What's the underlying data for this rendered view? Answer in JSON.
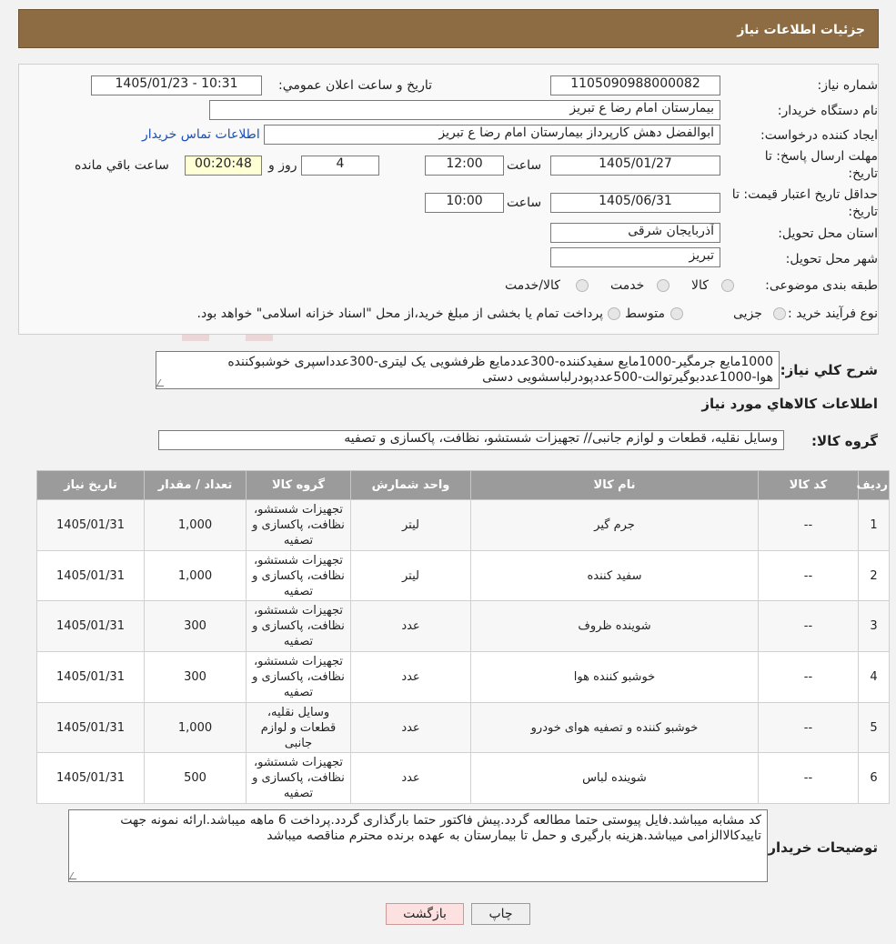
{
  "header": {
    "title": "جزئیات اطلاعات نیاز"
  },
  "form": {
    "need_number_label": "شماره نیاز:",
    "need_number": "1105090988000082",
    "announce_label": "تاریخ و ساعت اعلان عمومي:",
    "announce_value": "1405/01/23 - 10:31",
    "buyer_org_label": "نام دستگاه خريدار:",
    "buyer_org": "بیمارستان امام رضا  ع  تبریز",
    "requester_label": "ايجاد كننده درخواست:",
    "requester": "ابوالفضل دهش کارپرداز بیمارستان امام رضا  ع  تبریز",
    "contact_link": "اطلاعات تماس خريدار",
    "deadline_label_1": "مهلت ارسال پاسخ: تا",
    "deadline_label_2": "تاريخ:",
    "deadline_date": "1405/01/27",
    "time_label": "ساعت",
    "deadline_time": "12:00",
    "days_value": "4",
    "days_label": "روز و",
    "remaining_time": "00:20:48",
    "remaining_label": "ساعت باقي مانده",
    "validity_label_1": "حداقل تاريخ اعتبار قيمت: تا",
    "validity_label_2": "تاريخ:",
    "validity_date": "1405/06/31",
    "validity_time": "10:00",
    "province_label": "استان محل تحويل:",
    "province": "آذربایجان شرقی",
    "city_label": "شهر محل تحويل:",
    "city": "تبریز",
    "category_label": "طبقه بندی موضوعی:",
    "category_options": [
      "کالا",
      "خدمت",
      "کالا/خدمت"
    ],
    "purchase_type_label": "نوع فرآيند خريد :",
    "purchase_options": [
      "جزیی",
      "متوسط"
    ],
    "purchase_note": "پرداخت تمام يا بخشی از مبلغ خريد،از محل \"اسناد خزانه اسلامی\" خواهد بود."
  },
  "summary": {
    "label": "شرح كلي نياز:",
    "text": "1000مایع جرمگیر-1000مایع سفیدکننده-300عددمایع ظرفشویی یک لیتری-300عدداسپری خوشبوکننده هوا-1000عددبوگیرتوالت-500عددپودرلباسشویی دستی"
  },
  "goods": {
    "section_title": "اطلاعات كالاهاي مورد نياز",
    "group_label": "گروه كالا:",
    "group_value": "وسایل نقلیه، قطعات و لوازم جانبی// تجهیزات شستشو، نظافت، پاکسازی و تصفیه"
  },
  "table": {
    "headers": [
      "رديف",
      "كد كالا",
      "نام كالا",
      "واحد شمارش",
      "گروه كالا",
      "تعداد / مقدار",
      "تاريخ نياز"
    ],
    "rows": [
      [
        "1",
        "--",
        "جرم گیر",
        "لیتر",
        "تجهیزات شستشو، نظافت، پاکسازی و تصفیه",
        "1,000",
        "1405/01/31"
      ],
      [
        "2",
        "--",
        "سفید کننده",
        "لیتر",
        "تجهیزات شستشو، نظافت، پاکسازی و تصفیه",
        "1,000",
        "1405/01/31"
      ],
      [
        "3",
        "--",
        "شوینده ظروف",
        "عدد",
        "تجهیزات شستشو، نظافت، پاکسازی و تصفیه",
        "300",
        "1405/01/31"
      ],
      [
        "4",
        "--",
        "خوشبو کننده هوا",
        "عدد",
        "تجهیزات شستشو، نظافت، پاکسازی و تصفیه",
        "300",
        "1405/01/31"
      ],
      [
        "5",
        "--",
        "خوشبو کننده و تصفیه هوای خودرو",
        "عدد",
        "وسایل نقلیه، قطعات و لوازم جانبی",
        "1,000",
        "1405/01/31"
      ],
      [
        "6",
        "--",
        "شوینده لباس",
        "عدد",
        "تجهیزات شستشو، نظافت، پاکسازی و تصفیه",
        "500",
        "1405/01/31"
      ]
    ]
  },
  "buyer_notes": {
    "label": "توضيحات خريدار:",
    "text": "کد مشابه میباشد.فایل پیوستی حتما مطالعه گردد.پیش فاکتور حتما بارگذاری گردد.پرداخت 6 ماهه میباشد.ارائه نمونه جهت تاییدکالاالزامی میباشد.هزینه بارگیری و حمل تا بیمارستان به عهده برنده محترم مناقصه میباشد"
  },
  "buttons": {
    "print": "چاپ",
    "back": "بازگشت"
  },
  "watermark": {
    "text": "AriaTender.neT"
  },
  "colors": {
    "header_bg": "#8d6c43",
    "table_header_bg": "#9b9b9b",
    "link": "#1a4fb5"
  }
}
